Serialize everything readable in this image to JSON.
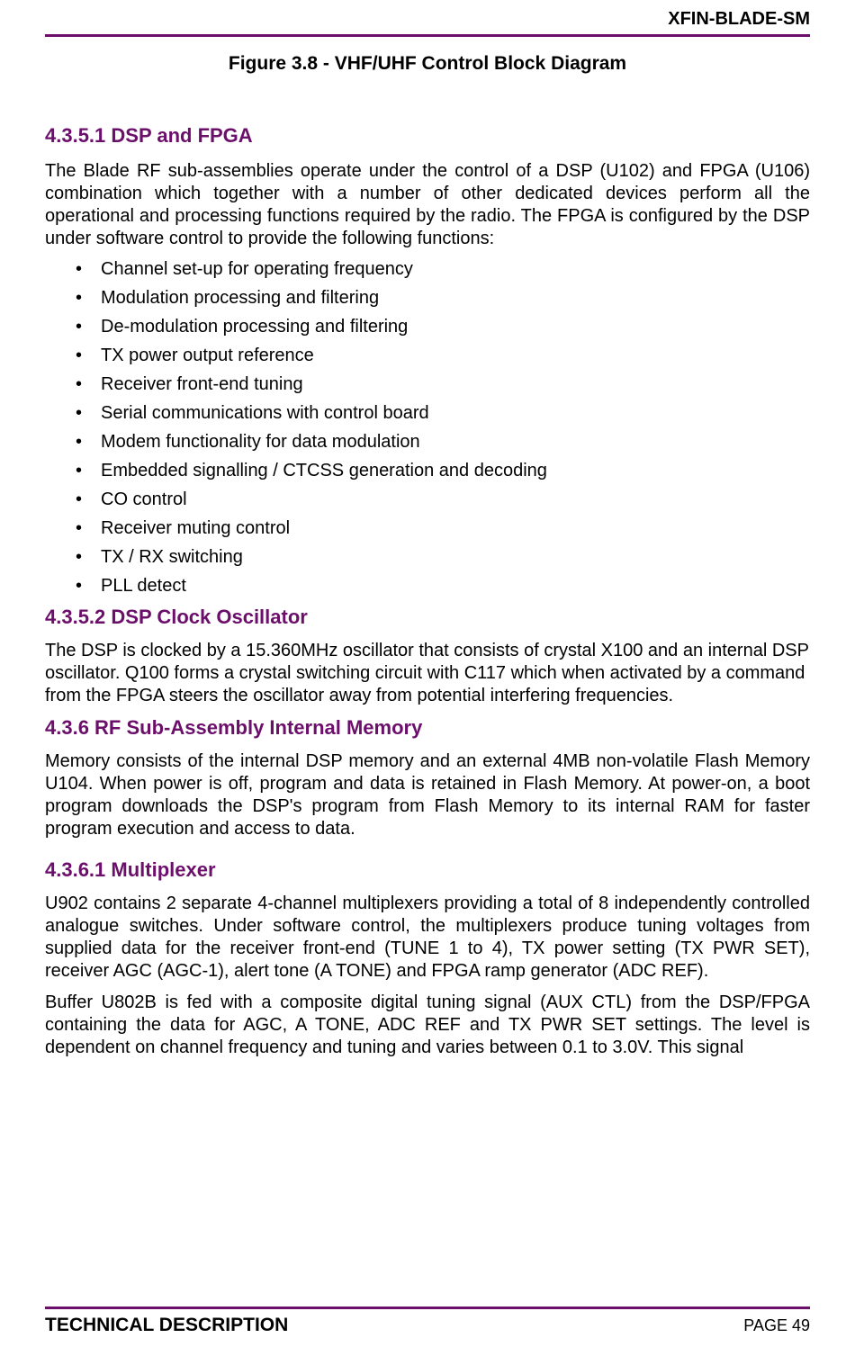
{
  "header": {
    "doc_code": "XFIN-BLADE-SM"
  },
  "figure_caption": "Figure 3.8 - VHF/UHF Control Block Diagram",
  "sections": {
    "s1": {
      "title": "4.3.5.1 DSP and FPGA",
      "para1": "The Blade RF sub-assemblies operate under the control of a DSP (U102) and FPGA (U106) combination which together with a number of other dedicated devices perform all the operational and processing functions required by the radio. The FPGA is configured by the DSP under software control to provide the following functions:",
      "bullets": [
        "Channel set-up for operating frequency",
        "Modulation processing and filtering",
        "De-modulation processing and filtering",
        "TX power output reference",
        "Receiver front-end tuning",
        "Serial communications with control board",
        "Modem functionality for data modulation",
        "Embedded signalling / CTCSS generation and decoding",
        "CO control",
        "Receiver muting control",
        "TX / RX switching",
        "PLL detect"
      ]
    },
    "s2": {
      "title": "4.3.5.2 DSP Clock Oscillator",
      "para1": "The DSP is clocked by a 15.360MHz oscillator that consists of crystal X100 and an internal DSP oscillator. Q100 forms a crystal switching circuit with C117 which when activated by a command from the FPGA steers the oscillator away from potential interfering frequencies."
    },
    "s3": {
      "title": "4.3.6 RF Sub-Assembly Internal Memory",
      "para1": "Memory consists of the internal DSP memory and an external 4MB non-volatile Flash Memory U104. When power is off, program and data is retained in Flash Memory. At power-on, a boot program downloads the DSP's program from Flash Memory to its internal RAM for faster program execution and access to data."
    },
    "s4": {
      "title": "4.3.6.1 Multiplexer",
      "para1": "U902 contains 2 separate 4-channel multiplexers providing a total of 8 independently controlled analogue switches. Under software control, the multiplexers produce tuning voltages from supplied data for the receiver front-end (TUNE 1 to 4), TX power setting (TX PWR SET), receiver AGC (AGC-1), alert tone (A TONE) and FPGA ramp generator (ADC REF).",
      "para2": "Buffer U802B is fed with a composite digital tuning signal (AUX CTL) from the DSP/FPGA containing the data for AGC, A TONE, ADC REF and TX PWR SET settings. The level is dependent on channel frequency and tuning and varies between 0.1 to 3.0V. This signal"
    }
  },
  "footer": {
    "left": "TECHNICAL DESCRIPTION",
    "right": "PAGE 49"
  }
}
